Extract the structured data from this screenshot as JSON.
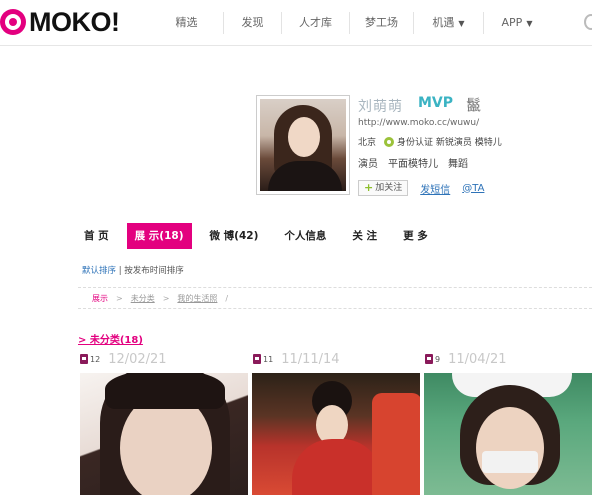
{
  "brand": {
    "logo_text": "MOKO!",
    "accent": "#e3007f"
  },
  "nav": {
    "items": [
      {
        "label": "精选",
        "caret": ""
      },
      {
        "label": "发现",
        "caret": ""
      },
      {
        "label": "人才库",
        "caret": ""
      },
      {
        "label": "梦工场",
        "caret": ""
      },
      {
        "label": "机遇",
        "caret": "▼"
      },
      {
        "label": "APP",
        "caret": "▼"
      }
    ]
  },
  "profile": {
    "name": "刘萌萌",
    "level": "MVP",
    "level_badge": "鬣",
    "url": "http://www.moko.cc/wuwu/",
    "city": "北京",
    "verify_text": "身份认证 新锐演员 模特儿",
    "tags": [
      "演员",
      "平面模特儿",
      "舞蹈"
    ],
    "actions": {
      "follow": "加关注",
      "message": "发短信",
      "mention": "@TA"
    }
  },
  "tabs": [
    {
      "label": "首 页",
      "active": false
    },
    {
      "label": "展 示(18)",
      "active": true
    },
    {
      "label": "微 博(42)",
      "active": false
    },
    {
      "label": "个人信息",
      "active": false
    },
    {
      "label": "关 注",
      "active": false
    },
    {
      "label": "更 多",
      "active": false
    }
  ],
  "sort": {
    "default": "默认排序",
    "separator": " | ",
    "by_time": "按发布时间排序"
  },
  "breadcrumb": {
    "root": "展示",
    "level1": "未分类",
    "level2": "我的生活照"
  },
  "category": {
    "title": "> 未分类(18)"
  },
  "albums": [
    {
      "count": "12",
      "date": "12/02/21"
    },
    {
      "count": "11",
      "date": "11/11/14"
    },
    {
      "count": "9",
      "date": "11/04/21"
    }
  ]
}
